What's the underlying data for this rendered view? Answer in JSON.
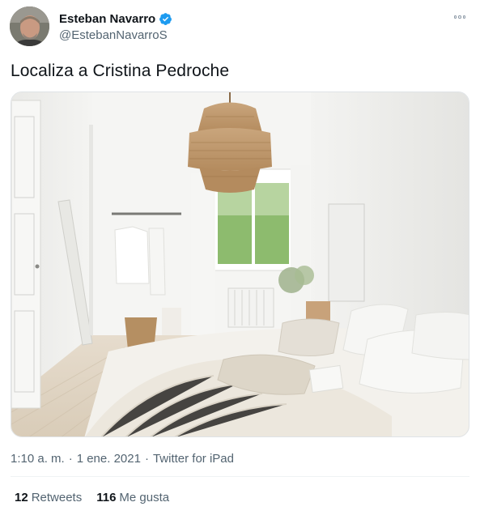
{
  "author": {
    "display_name": "Esteban Navarro",
    "handle": "@EstebanNavarroS",
    "avatar_icon": "user-avatar-photo",
    "verified_icon": "verified-badge-icon",
    "verified_color": "#1d9bf0"
  },
  "tweet": {
    "text": "Localiza a Cristina Pedroche",
    "media_icon": "bedroom-photo",
    "time": "1:10 a. m.",
    "separator": "·",
    "date": "1 ene. 2021",
    "source": "Twitter for iPad"
  },
  "stats": {
    "retweets_count": "12",
    "retweets_label": "Retweets",
    "likes_count": "116",
    "likes_label": "Me gusta"
  },
  "actions": {
    "more_icon": "more-options-icon"
  }
}
